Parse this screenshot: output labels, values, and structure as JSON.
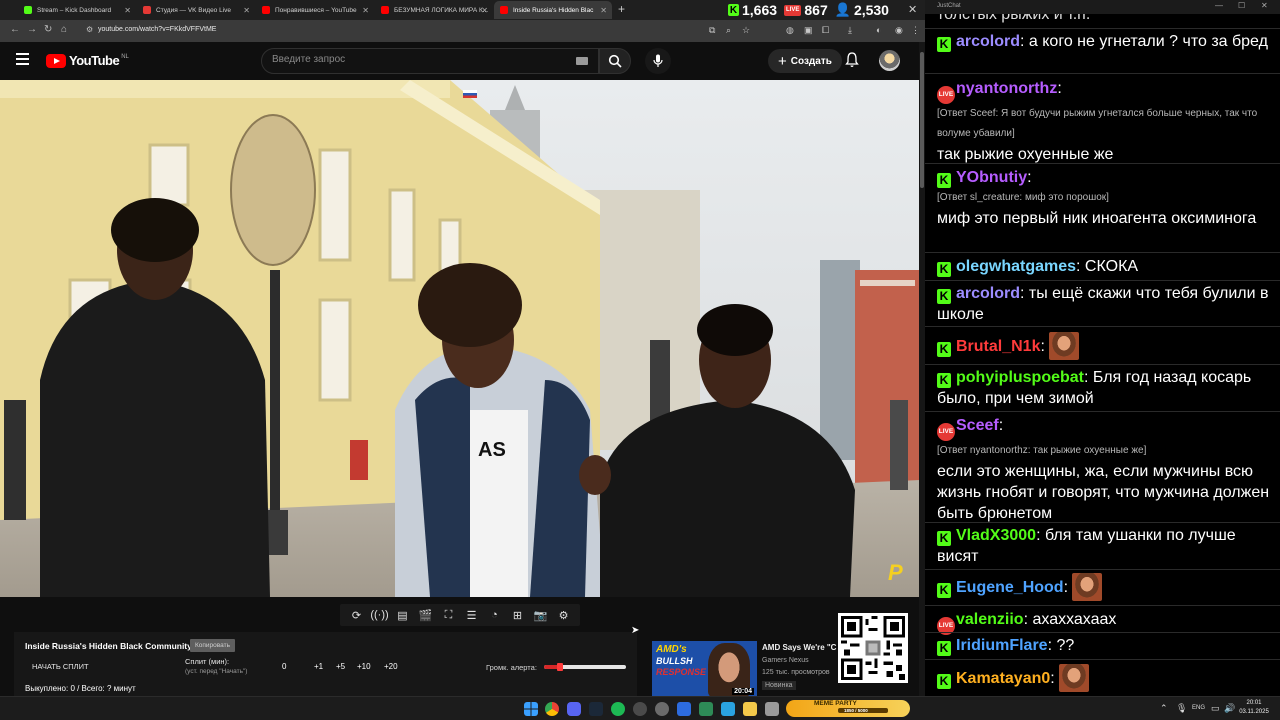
{
  "browser": {
    "tabs": [
      {
        "label": "Stream – Kick Dashboard",
        "icon": "kick-icon",
        "color": "#53fc18"
      },
      {
        "label": "Студия — VK Видео Live",
        "icon": "vk-video-icon",
        "color": "#e53935"
      },
      {
        "label": "Понравившиеся – YouTube",
        "icon": "youtube-icon",
        "color": "#ff0000"
      },
      {
        "label": "БЕЗУМНАЯ ЛОГИКА МИРА К...",
        "icon": "youtube-icon",
        "color": "#ff0000"
      },
      {
        "label": "Inside Russia's Hidden Blac",
        "icon": "youtube-icon",
        "color": "#ff0000"
      }
    ],
    "active_tab": 4,
    "url": "youtube.com/watch?v=FKkdVFFVtME"
  },
  "stream_stats": {
    "kick_viewers": "1,663",
    "vk_viewers": "867",
    "total_viewers": "2,530"
  },
  "youtube": {
    "logo_text": "YouTube",
    "country_code": "NL",
    "search_placeholder": "Введите запрос",
    "create_label": "Создать",
    "video_watermark": "P"
  },
  "split_panel": {
    "title": "Inside Russia's Hidden Black Community",
    "copy_label": "Копировать",
    "start_label": "НАЧАТЬ СПЛИТ",
    "split_label": "Сплит (мин):",
    "split_hint": "(уст. перед \"Начать\")",
    "split_value": "0",
    "buttons": [
      "+1",
      "+5",
      "+10",
      "+20"
    ],
    "volume_label": "Громк. алерта:",
    "volume_level": 0.2,
    "footer": "Выкуплено: 0 / Всего: ? минут"
  },
  "recommended": {
    "title": "AMD Says We're \"C",
    "channel": "Gamers Nexus",
    "views": "125 тыс. просмотров",
    "badge": "Новинка",
    "duration": "20:04",
    "thumb_line1": "AMD's",
    "thumb_line2": "BULLSH",
    "thumb_line3": "RESPONSE"
  },
  "chat": {
    "window_title": "JustChat",
    "top_fragment": "толстых рыжих и т.п.",
    "messages": [
      {
        "platform": "kick",
        "user": "arcolord",
        "color": "#9c8cff",
        "text": "а кого не угнетали ? что за бред"
      },
      {
        "platform": "vk",
        "user": "nyantonorthz",
        "color": "#b65dff",
        "reply": "[Ответ Sceef: Я вот будучи рыжим угнетался больше черных, так что волуме убавили]",
        "text": "так рыжие охуенные же"
      },
      {
        "platform": "kick",
        "user": "YObnutiy",
        "color": "#b65dff",
        "reply": "[Ответ sl_creature: миф это порошок]",
        "text": "миф это первый ник иноагента оксиминога"
      },
      {
        "platform": "kick",
        "user": "olegwhatgames",
        "color": "#7ad6ff",
        "text": "СКОКА"
      },
      {
        "platform": "kick",
        "user": "arcolord",
        "color": "#9c8cff",
        "text": "ты ещё скажи что тебя булили в школе"
      },
      {
        "platform": "kick",
        "user": "Brutal_N1k",
        "color": "#ff3b3b",
        "text": "",
        "emote": "laughing-emote"
      },
      {
        "platform": "kick",
        "user": "pohyipluspoebat",
        "color": "#53fc18",
        "text": "Бля год назад косарь было, при чем зимой"
      },
      {
        "platform": "vk",
        "user": "Sceef",
        "color": "#b65dff",
        "reply": "[Ответ nyantonorthz: так рыжие охуенные же]",
        "text": "если это женщины, жа, если мужчины всю жизнь гнобят и говорят, что мужчина должен быть брюнетом"
      },
      {
        "platform": "kick",
        "user": "VladX3000",
        "color": "#53fc18",
        "text": "бля там ушанки по лучше висят"
      },
      {
        "platform": "kick",
        "user": "Eugene_Hood",
        "color": "#4fa3ff",
        "text": "",
        "emote": "laughing-emote"
      },
      {
        "platform": "vk",
        "user": "valenziio",
        "color": "#53fc18",
        "text": "ахаххахаах"
      },
      {
        "platform": "kick",
        "user": "IridiumFlare",
        "color": "#4fa3ff",
        "text": "??"
      },
      {
        "platform": "kick",
        "user": "Kamatayan0",
        "color": "#ffb020",
        "text": "",
        "emote": "laughing-emote"
      }
    ]
  },
  "taskbar": {
    "meme_label": "MEME PARTY",
    "meme_progress": "1850 / 5000",
    "language": "ENG",
    "time": "20:01",
    "date": "03.11.2025"
  }
}
